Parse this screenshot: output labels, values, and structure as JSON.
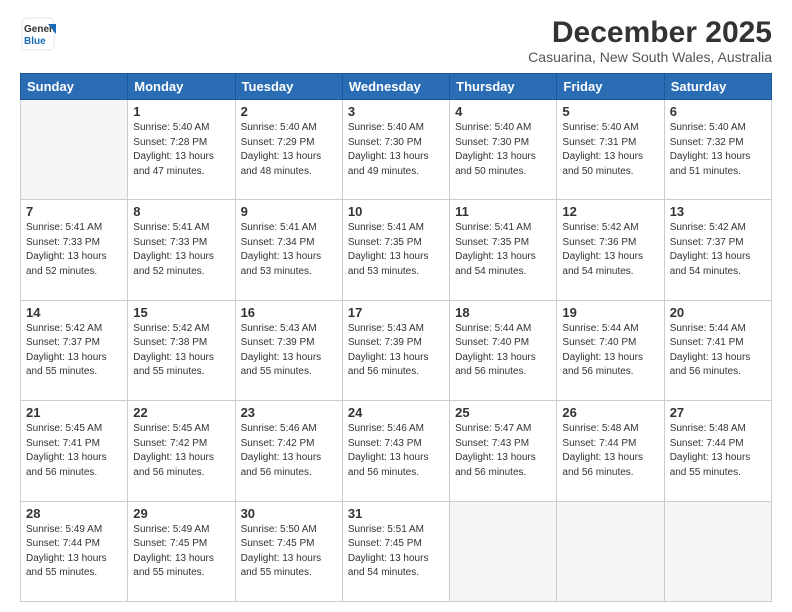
{
  "header": {
    "logo_general": "General",
    "logo_blue": "Blue",
    "month_title": "December 2025",
    "subtitle": "Casuarina, New South Wales, Australia"
  },
  "days_of_week": [
    "Sunday",
    "Monday",
    "Tuesday",
    "Wednesday",
    "Thursday",
    "Friday",
    "Saturday"
  ],
  "weeks": [
    [
      {
        "day": "",
        "info": ""
      },
      {
        "day": "1",
        "info": "Sunrise: 5:40 AM\nSunset: 7:28 PM\nDaylight: 13 hours\nand 47 minutes."
      },
      {
        "day": "2",
        "info": "Sunrise: 5:40 AM\nSunset: 7:29 PM\nDaylight: 13 hours\nand 48 minutes."
      },
      {
        "day": "3",
        "info": "Sunrise: 5:40 AM\nSunset: 7:30 PM\nDaylight: 13 hours\nand 49 minutes."
      },
      {
        "day": "4",
        "info": "Sunrise: 5:40 AM\nSunset: 7:30 PM\nDaylight: 13 hours\nand 50 minutes."
      },
      {
        "day": "5",
        "info": "Sunrise: 5:40 AM\nSunset: 7:31 PM\nDaylight: 13 hours\nand 50 minutes."
      },
      {
        "day": "6",
        "info": "Sunrise: 5:40 AM\nSunset: 7:32 PM\nDaylight: 13 hours\nand 51 minutes."
      }
    ],
    [
      {
        "day": "7",
        "info": "Sunrise: 5:41 AM\nSunset: 7:33 PM\nDaylight: 13 hours\nand 52 minutes."
      },
      {
        "day": "8",
        "info": "Sunrise: 5:41 AM\nSunset: 7:33 PM\nDaylight: 13 hours\nand 52 minutes."
      },
      {
        "day": "9",
        "info": "Sunrise: 5:41 AM\nSunset: 7:34 PM\nDaylight: 13 hours\nand 53 minutes."
      },
      {
        "day": "10",
        "info": "Sunrise: 5:41 AM\nSunset: 7:35 PM\nDaylight: 13 hours\nand 53 minutes."
      },
      {
        "day": "11",
        "info": "Sunrise: 5:41 AM\nSunset: 7:35 PM\nDaylight: 13 hours\nand 54 minutes."
      },
      {
        "day": "12",
        "info": "Sunrise: 5:42 AM\nSunset: 7:36 PM\nDaylight: 13 hours\nand 54 minutes."
      },
      {
        "day": "13",
        "info": "Sunrise: 5:42 AM\nSunset: 7:37 PM\nDaylight: 13 hours\nand 54 minutes."
      }
    ],
    [
      {
        "day": "14",
        "info": "Sunrise: 5:42 AM\nSunset: 7:37 PM\nDaylight: 13 hours\nand 55 minutes."
      },
      {
        "day": "15",
        "info": "Sunrise: 5:42 AM\nSunset: 7:38 PM\nDaylight: 13 hours\nand 55 minutes."
      },
      {
        "day": "16",
        "info": "Sunrise: 5:43 AM\nSunset: 7:39 PM\nDaylight: 13 hours\nand 55 minutes."
      },
      {
        "day": "17",
        "info": "Sunrise: 5:43 AM\nSunset: 7:39 PM\nDaylight: 13 hours\nand 56 minutes."
      },
      {
        "day": "18",
        "info": "Sunrise: 5:44 AM\nSunset: 7:40 PM\nDaylight: 13 hours\nand 56 minutes."
      },
      {
        "day": "19",
        "info": "Sunrise: 5:44 AM\nSunset: 7:40 PM\nDaylight: 13 hours\nand 56 minutes."
      },
      {
        "day": "20",
        "info": "Sunrise: 5:44 AM\nSunset: 7:41 PM\nDaylight: 13 hours\nand 56 minutes."
      }
    ],
    [
      {
        "day": "21",
        "info": "Sunrise: 5:45 AM\nSunset: 7:41 PM\nDaylight: 13 hours\nand 56 minutes."
      },
      {
        "day": "22",
        "info": "Sunrise: 5:45 AM\nSunset: 7:42 PM\nDaylight: 13 hours\nand 56 minutes."
      },
      {
        "day": "23",
        "info": "Sunrise: 5:46 AM\nSunset: 7:42 PM\nDaylight: 13 hours\nand 56 minutes."
      },
      {
        "day": "24",
        "info": "Sunrise: 5:46 AM\nSunset: 7:43 PM\nDaylight: 13 hours\nand 56 minutes."
      },
      {
        "day": "25",
        "info": "Sunrise: 5:47 AM\nSunset: 7:43 PM\nDaylight: 13 hours\nand 56 minutes."
      },
      {
        "day": "26",
        "info": "Sunrise: 5:48 AM\nSunset: 7:44 PM\nDaylight: 13 hours\nand 56 minutes."
      },
      {
        "day": "27",
        "info": "Sunrise: 5:48 AM\nSunset: 7:44 PM\nDaylight: 13 hours\nand 55 minutes."
      }
    ],
    [
      {
        "day": "28",
        "info": "Sunrise: 5:49 AM\nSunset: 7:44 PM\nDaylight: 13 hours\nand 55 minutes."
      },
      {
        "day": "29",
        "info": "Sunrise: 5:49 AM\nSunset: 7:45 PM\nDaylight: 13 hours\nand 55 minutes."
      },
      {
        "day": "30",
        "info": "Sunrise: 5:50 AM\nSunset: 7:45 PM\nDaylight: 13 hours\nand 55 minutes."
      },
      {
        "day": "31",
        "info": "Sunrise: 5:51 AM\nSunset: 7:45 PM\nDaylight: 13 hours\nand 54 minutes."
      },
      {
        "day": "",
        "info": ""
      },
      {
        "day": "",
        "info": ""
      },
      {
        "day": "",
        "info": ""
      }
    ]
  ]
}
